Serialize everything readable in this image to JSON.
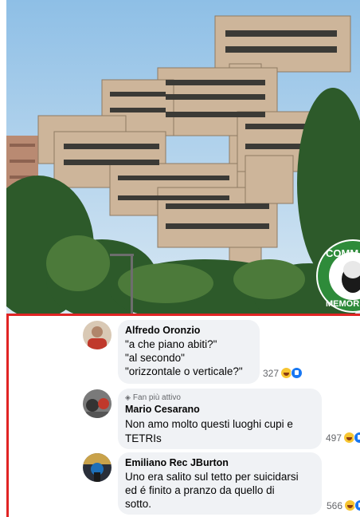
{
  "post": {
    "logo_text_top": "COMM",
    "logo_text_bottom": "MEMOR"
  },
  "comments": [
    {
      "author": "Alfredo Oronzio",
      "badge": "",
      "lines": [
        "\"a che piano abiti?\"",
        "\"al secondo\"",
        "\"orizzontale o verticale?\""
      ],
      "reaction_count": "327",
      "reactions": [
        "haha-icon",
        "like-icon"
      ]
    },
    {
      "author": "Mario Cesarano",
      "badge": "Fan più attivo",
      "lines": [
        "Non amo molto questi luoghi cupi e",
        "TETRIs"
      ],
      "reaction_count": "497",
      "reactions": [
        "haha-icon",
        "like-icon"
      ]
    },
    {
      "author": "Emiliano Rec JBurton",
      "badge": "",
      "lines": [
        "Uno era salito sul tetto per suicidarsi",
        "ed é finito a pranzo da quello di",
        "sotto."
      ],
      "reaction_count": "566",
      "reactions": [
        "haha-icon",
        "like-icon"
      ]
    }
  ],
  "colors": {
    "accent_red": "#e02424",
    "bubble_bg": "#f0f2f5",
    "sky": "#a9cdea",
    "building": "#cdb59a",
    "logo_green": "#2e8b3a"
  }
}
